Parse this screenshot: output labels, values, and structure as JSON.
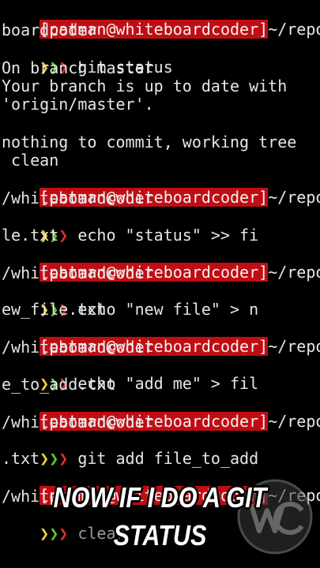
{
  "terminal": {
    "prompt_host": "[patman@whiteboardcoder]",
    "lines": {
      "l1_path": "~/repos",
      "l2": "boardcoder",
      "l3_cmd": " git status",
      "l4": "On branch master",
      "l5": "Your branch is up to date with",
      "l6": "'origin/master'.",
      "l8": "nothing to commit, working tree",
      "l9": " clean",
      "l10_path": "~/repos",
      "l11": "/whiteboardcoder",
      "l12_cmd": " echo \"status\" >> fi",
      "l13": "le.txt",
      "l14_path": "~/repos",
      "l15": "/whiteboardcoder",
      "l16_cmd": " echo \"new file\" > n",
      "l17": "ew_file.txt",
      "l18_path": "~/repos",
      "l19": "/whiteboardcoder",
      "l20_cmd": " echo \"add me\" > fil",
      "l21": "e_to_add.txt",
      "l22_path": "~/repos",
      "l23": "/whiteboardcoder",
      "l24_cmd": " git add file_to_add",
      "l25": ".txt",
      "l26_path": "~/repos",
      "l27": "/white",
      "l28_cmd": " clear"
    },
    "arrows": [
      "❯",
      "❯",
      "❯"
    ]
  },
  "caption": {
    "line1": "NOW IF I DO A GIT",
    "line2": "STATUS"
  },
  "logo": {
    "name": "whiteboardcoder-logo",
    "text": "WC"
  },
  "colors": {
    "prompt_bg": "#c00d13",
    "arrow_yellow": "#f2d32a",
    "arrow_green": "#63c92c",
    "arrow_red": "#e03030",
    "text": "#e6e6e6",
    "background": "#000000"
  }
}
